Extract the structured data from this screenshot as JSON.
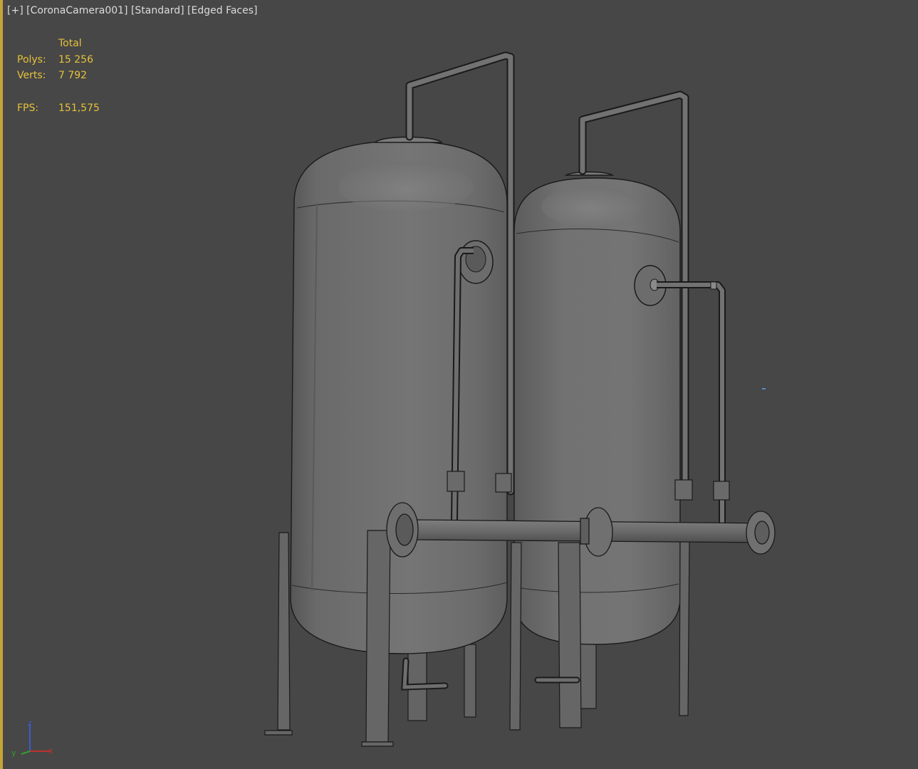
{
  "viewport": {
    "label": {
      "plus": "[+]",
      "camera": "[CoronaCamera001]",
      "shading": "[Standard]",
      "display": "[Edged Faces]"
    },
    "stats": {
      "header": "Total",
      "polys_label": "Polys:",
      "polys_value": "15 256",
      "verts_label": "Verts:",
      "verts_value": "7 792",
      "fps_label": "FPS:",
      "fps_value": "151,575"
    },
    "axis": {
      "z": "z",
      "y": "y",
      "x": "x"
    }
  },
  "colors": {
    "background": "#474747",
    "active_border": "#c5a437",
    "stats_text": "#e6c23a",
    "label_text": "#dcdcdc"
  }
}
